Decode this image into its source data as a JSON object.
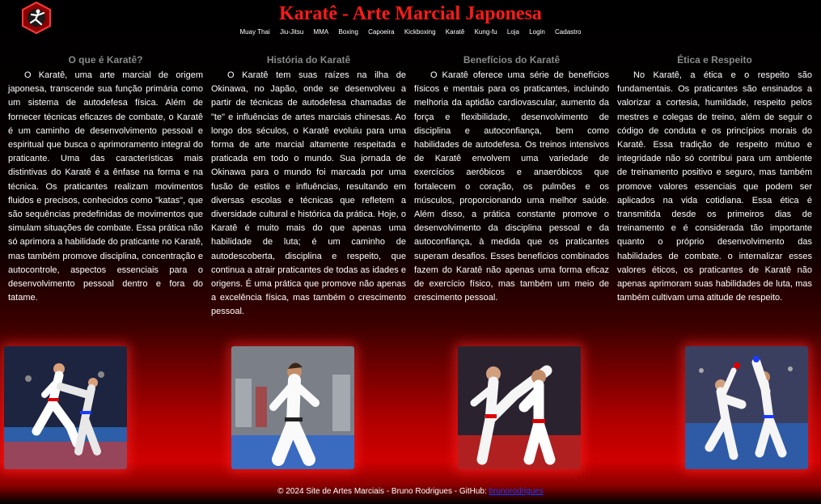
{
  "header": {
    "title": "Karatê - Arte Marcial Japonesa",
    "logo_icon": "karate-fighter-hexagon-logo",
    "title_color": "#ff1a1a"
  },
  "nav": {
    "items": [
      "Muay Thai",
      "Jiu-Jitsu",
      "MMA",
      "Boxing",
      "Capoeira",
      "Kickboxing",
      "Karatê",
      "Kung-fu",
      "Loja",
      "Login",
      "Cadastro"
    ]
  },
  "sections": [
    {
      "heading": "O que é Karatê?",
      "text": "O Karatê, uma arte marcial de origem japonesa, transcende sua função primária como um sistema de autodefesa física. Além de fornecer técnicas eficazes de combate, o Karatê é um caminho de desenvolvimento pessoal e espiritual que busca o aprimoramento integral do praticante. Uma das características mais distintivas do Karatê é a ênfase na forma e na técnica. Os praticantes realizam movimentos fluidos e precisos, conhecidos como \"katas\", que são sequências predefinidas de movimentos que simulam situações de combate. Essa prática não só aprimora a habilidade do praticante no Karatê, mas também promove disciplina, concentração e autocontrole, aspectos essenciais para o desenvolvimento pessoal dentro e fora do tatame."
    },
    {
      "heading": "História do Karatê",
      "text": "O Karatê tem suas raízes na ilha de Okinawa, no Japão, onde se desenvolveu a partir de técnicas de autodefesa chamadas de \"te\" e influências de artes marciais chinesas. Ao longo dos séculos, o Karatê evoluiu para uma forma de arte marcial altamente respeitada e praticada em todo o mundo. Sua jornada de Okinawa para o mundo foi marcada por uma fusão de estilos e influências, resultando em diversas escolas e técnicas que refletem a diversidade cultural e histórica da prática. Hoje, o Karatê é muito mais do que apenas uma habilidade de luta; é um caminho de autodescoberta, disciplina e respeito, que continua a atrair praticantes de todas as idades e origens. É uma prática que promove não apenas a excelência física, mas também o crescimento pessoal."
    },
    {
      "heading": "Benefícios do Karatê",
      "text": "O Karatê oferece uma série de benefícios físicos e mentais para os praticantes, incluindo melhoria da aptidão cardiovascular, aumento da força e flexibilidade, desenvolvimento de disciplina e autoconfiança, bem como habilidades de autodefesa. Os treinos intensivos de Karatê envolvem uma variedade de exercícios aeróbicos e anaeróbicos que fortalecem o coração, os pulmões e os músculos, proporcionando uma melhor saúde. Além disso, a prática constante promove o desenvolvimento da disciplina pessoal e da autoconfiança, à medida que os praticantes superam desafios. Esses benefícios combinados fazem do Karatê não apenas uma forma eficaz de exercício físico, mas também um meio de crescimento pessoal."
    },
    {
      "heading": "Ética e Respeito",
      "text": "No Karatê, a ética e o respeito são fundamentais. Os praticantes são ensinados a valorizar a cortesia, humildade, respeito pelos mestres e colegas de treino, além de seguir o código de conduta e os princípios morais do Karatê. Essa tradição de respeito mútuo e integridade não só contribui para um ambiente de treinamento positivo e seguro, mas também promove valores essenciais que podem ser aplicados na vida cotidiana. Essa ética é transmitida desde os primeiros dias de treinamento e é considerada tão importante quanto o próprio desenvolvimento das habilidades de combate. o internalizar esses valores éticos, os praticantes de Karatê não apenas aprimoram suas habilidades de luta, mas também cultivam uma atitude de respeito."
    }
  ],
  "photos": [
    {
      "icon": "karate-kick-photo"
    },
    {
      "icon": "karate-stance-photo"
    },
    {
      "icon": "karate-high-kick-photo"
    },
    {
      "icon": "karate-sparring-photo"
    }
  ],
  "footer": {
    "text": "© 2024 Site de Artes Marciais - Bruno Rodrigues - GitHub: ",
    "link_text": "brunorodrigues",
    "link_color": "#1a3cff"
  }
}
